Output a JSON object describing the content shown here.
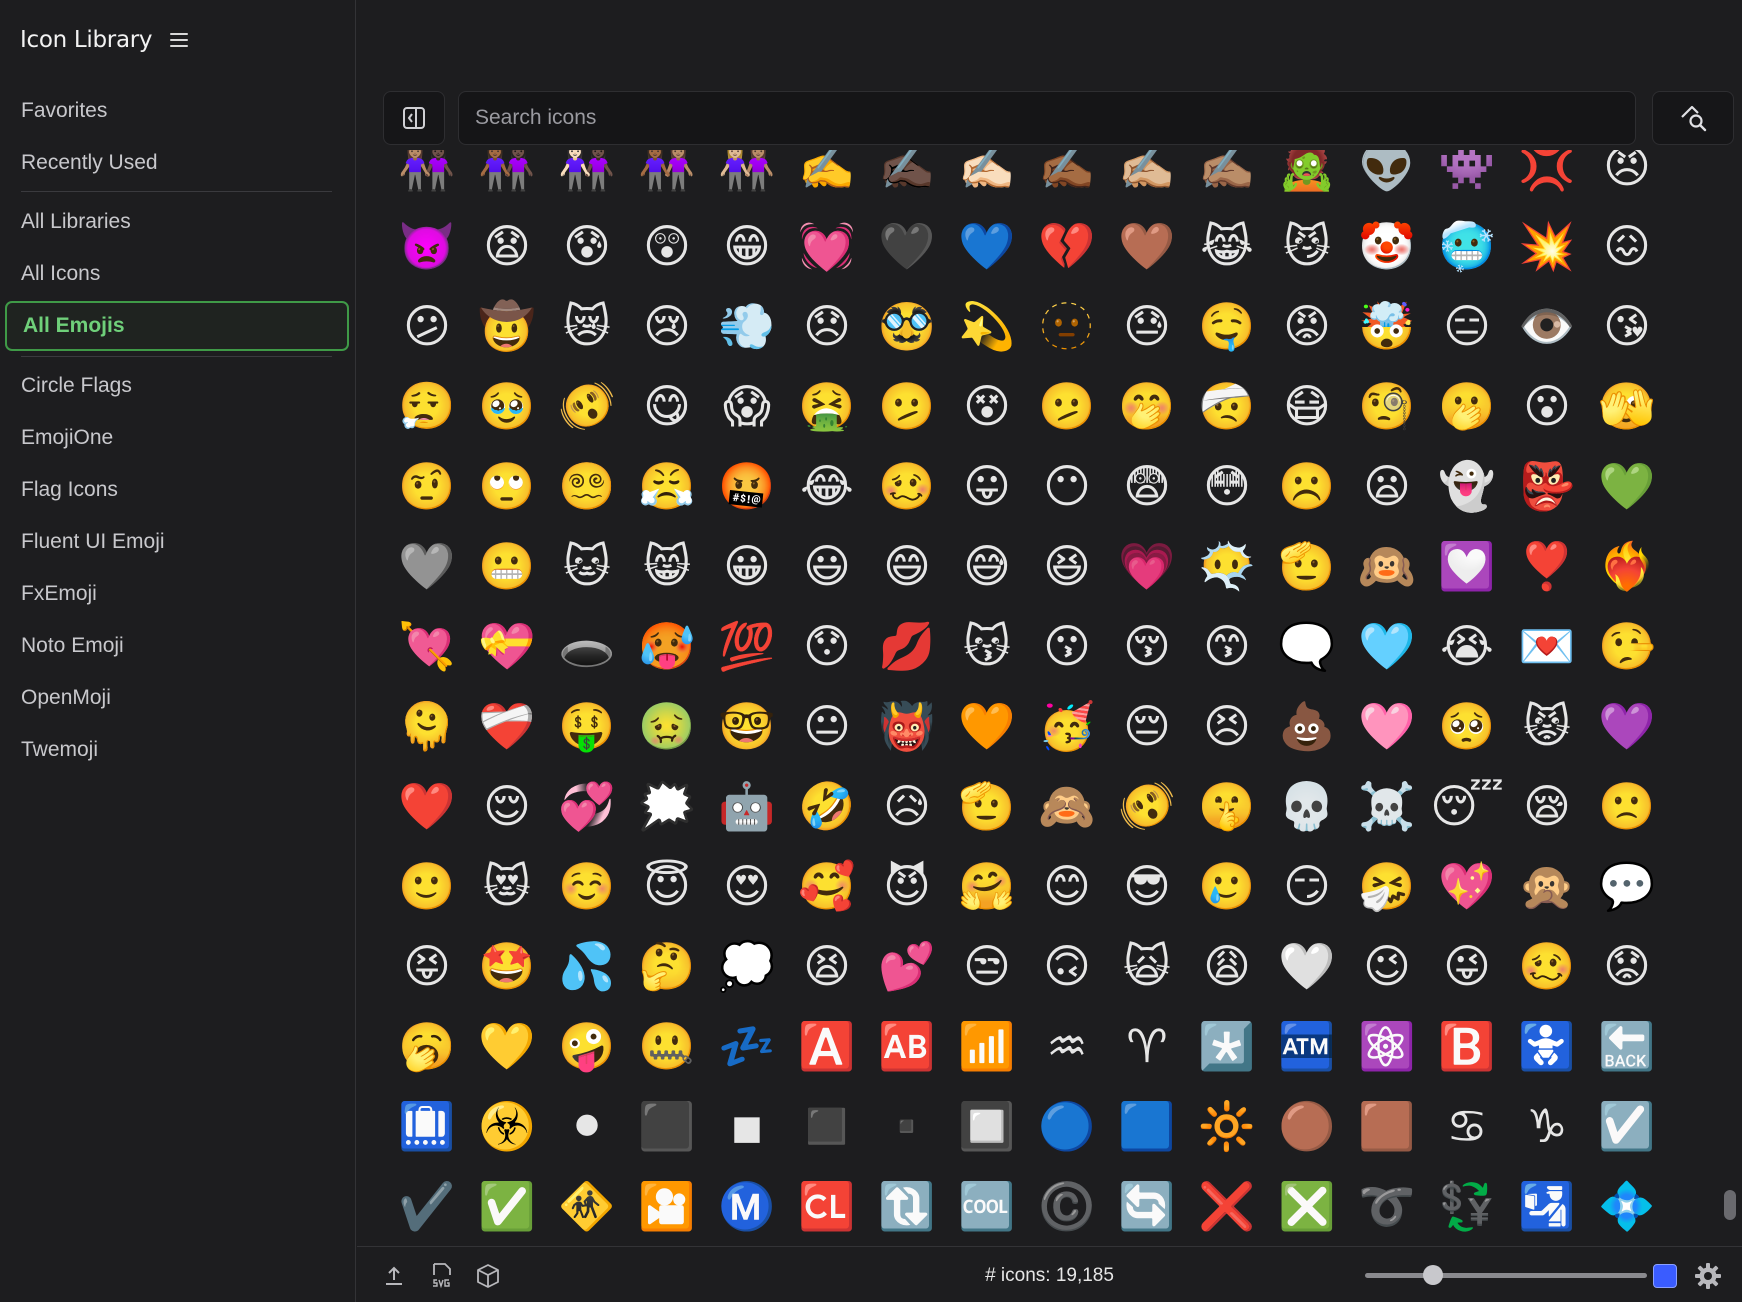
{
  "app": {
    "title": "Icon Library"
  },
  "sidebar": {
    "items": [
      {
        "label": "Favorites"
      },
      {
        "label": "Recently Used"
      },
      {
        "label": "All Libraries"
      },
      {
        "label": "All Icons"
      },
      {
        "label": "All Emojis"
      },
      {
        "label": "Circle Flags"
      },
      {
        "label": "EmojiOne"
      },
      {
        "label": "Flag Icons"
      },
      {
        "label": "Fluent UI Emoji"
      },
      {
        "label": "FxEmoji"
      },
      {
        "label": "Noto Emoji"
      },
      {
        "label": "OpenMoji"
      },
      {
        "label": "Twemoji"
      }
    ],
    "active": "All Emojis"
  },
  "search": {
    "placeholder": "Search icons",
    "value": ""
  },
  "icons": [
    "👩🏽‍🤝‍👩🏿",
    "👩🏾‍🤝‍👩🏿",
    "👩🏻‍🤝‍👩🏿",
    "👩🏾‍🤝‍👩🏽",
    "👩🏼‍🤝‍👩🏽",
    "✍️",
    "✍🏿",
    "✍🏻",
    "✍🏾",
    "✍🏼",
    "✍🏽",
    "🧟",
    "👽",
    "👾",
    "💢",
    "😠",
    "👿",
    "😧",
    "😰",
    "😲",
    "😁",
    "💓",
    "🖤",
    "💙",
    "💔",
    "🤎",
    "😹",
    "😼",
    "🤡",
    "🥶",
    "💥",
    "😖",
    "😕",
    "🤠",
    "😿",
    "😢",
    "💨",
    "😞",
    "🥸",
    "💫",
    "🫥",
    "😓",
    "🤤",
    "😡",
    "🤯",
    "😑",
    "👁️",
    "😘",
    "😮‍💨",
    "🥹",
    "🫨",
    "😋",
    "😱",
    "🤮",
    "🫤",
    "😵",
    "🫤",
    "🤭",
    "🤕",
    "😷",
    "🧐",
    "🫢",
    "😮",
    "🫣",
    "🤨",
    "🙄",
    "😵‍💫",
    "😤",
    "🤬",
    "😂",
    "🥴",
    "😛",
    "😶",
    "😨",
    "😳",
    "☹️",
    "😦",
    "👻",
    "👺",
    "💚",
    "🩶",
    "😬",
    "🐱",
    "😸",
    "😀",
    "😃",
    "😄",
    "😅",
    "😆",
    "💗",
    "😶‍🌫️",
    "🫡",
    "🙉",
    "💟",
    "❣️",
    "❤️‍🔥",
    "💘",
    "💝",
    "🕳️",
    "🥵",
    "💯",
    "😯",
    "💋",
    "😽",
    "😗",
    "😚",
    "😙",
    "🗨️",
    "🩵",
    "😭",
    "💌",
    "🤥",
    "🫠",
    "❤️‍🩹",
    "🤑",
    "🤢",
    "🤓",
    "😐",
    "👹",
    "🧡",
    "🥳",
    "😔",
    "😣",
    "💩",
    "🩷",
    "🥺",
    "😾",
    "💜",
    "❤️",
    "😌",
    "💞",
    "🗯️",
    "🤖",
    "🤣",
    "😥",
    "🫡",
    "🙈",
    "🫨",
    "🤫",
    "💀",
    "☠️",
    "😴",
    "😪",
    "🙁",
    "🙂",
    "😻",
    "☺️",
    "😇",
    "😍",
    "🥰",
    "😈",
    "🤗",
    "😊",
    "😎",
    "🥲",
    "😏",
    "🤧",
    "💖",
    "🙊",
    "💬",
    "😝",
    "🤩",
    "💦",
    "🤔",
    "💭",
    "😫",
    "💕",
    "😒",
    "🙃",
    "🙀",
    "😩",
    "🤍",
    "😉",
    "😜",
    "🥴",
    "😟",
    "🥱",
    "💛",
    "🤪",
    "🤐",
    "💤",
    "🅰️",
    "🆎",
    "📶",
    "♒",
    "♈",
    "*️⃣",
    "🏧",
    "⚛️",
    "🅱️",
    "🚼",
    "🔙",
    "🛄",
    "☣️",
    "⚫",
    "⬛",
    "◾",
    "◼️",
    "▪️",
    "🔲",
    "🔵",
    "🟦",
    "🔆",
    "🟤",
    "🟫",
    "♋",
    "♑",
    "☑️",
    "✔️",
    "✅",
    "🚸",
    "🎦",
    "Ⓜ️",
    "🆑",
    "🔃",
    "🆒",
    "©️",
    "🔄",
    "❌",
    "❎",
    "➰",
    "💱",
    "🛂",
    "💠"
  ],
  "status": {
    "count_label": "# icons: 19,185",
    "size_slider_value": 0.22,
    "accent_color": "#3a5cff"
  },
  "colors": {
    "active_border": "#3f9a47",
    "active_text": "#6fd07a",
    "background": "#1d1d1f"
  }
}
